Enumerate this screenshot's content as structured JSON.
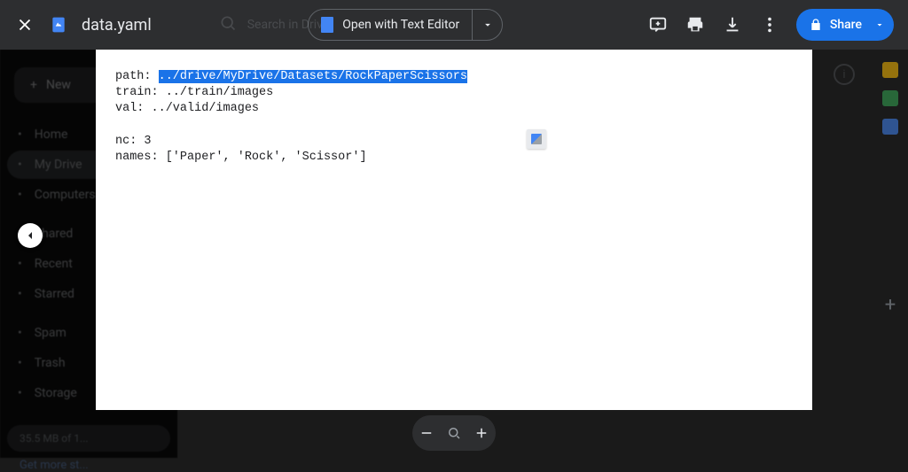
{
  "topbar": {
    "filename": "data.yaml",
    "search_placeholder": "Search in Drive",
    "open_with_label": "Open with Text Editor",
    "share_label": "Share"
  },
  "sidebar": {
    "new_label": "New",
    "items": [
      {
        "label": "Home",
        "icon": "home"
      },
      {
        "label": "My Drive",
        "icon": "drive"
      },
      {
        "label": "Computers",
        "icon": "computers"
      },
      {
        "label": "Shared",
        "icon": "shared"
      },
      {
        "label": "Recent",
        "icon": "recent"
      },
      {
        "label": "Starred",
        "icon": "star"
      },
      {
        "label": "Spam",
        "icon": "spam"
      },
      {
        "label": "Trash",
        "icon": "trash"
      },
      {
        "label": "Storage",
        "icon": "storage"
      }
    ],
    "storage_text": "35.5 MB of 1...",
    "get_more": "Get more st..."
  },
  "file_content": {
    "lines": [
      {
        "prefix": "path: ",
        "highlighted": "../drive/MyDrive/Datasets/RockPaperScissors",
        "suffix": ""
      },
      {
        "prefix": "train: ../train/images",
        "highlighted": "",
        "suffix": ""
      },
      {
        "prefix": "val: ../valid/images",
        "highlighted": "",
        "suffix": ""
      },
      {
        "prefix": "",
        "highlighted": "",
        "suffix": ""
      },
      {
        "prefix": "nc: 3",
        "highlighted": "",
        "suffix": ""
      },
      {
        "prefix": "names: ['Paper', 'Rock', 'Scissor']",
        "highlighted": "",
        "suffix": ""
      }
    ]
  },
  "colors": {
    "accent": "#1a73e8"
  }
}
